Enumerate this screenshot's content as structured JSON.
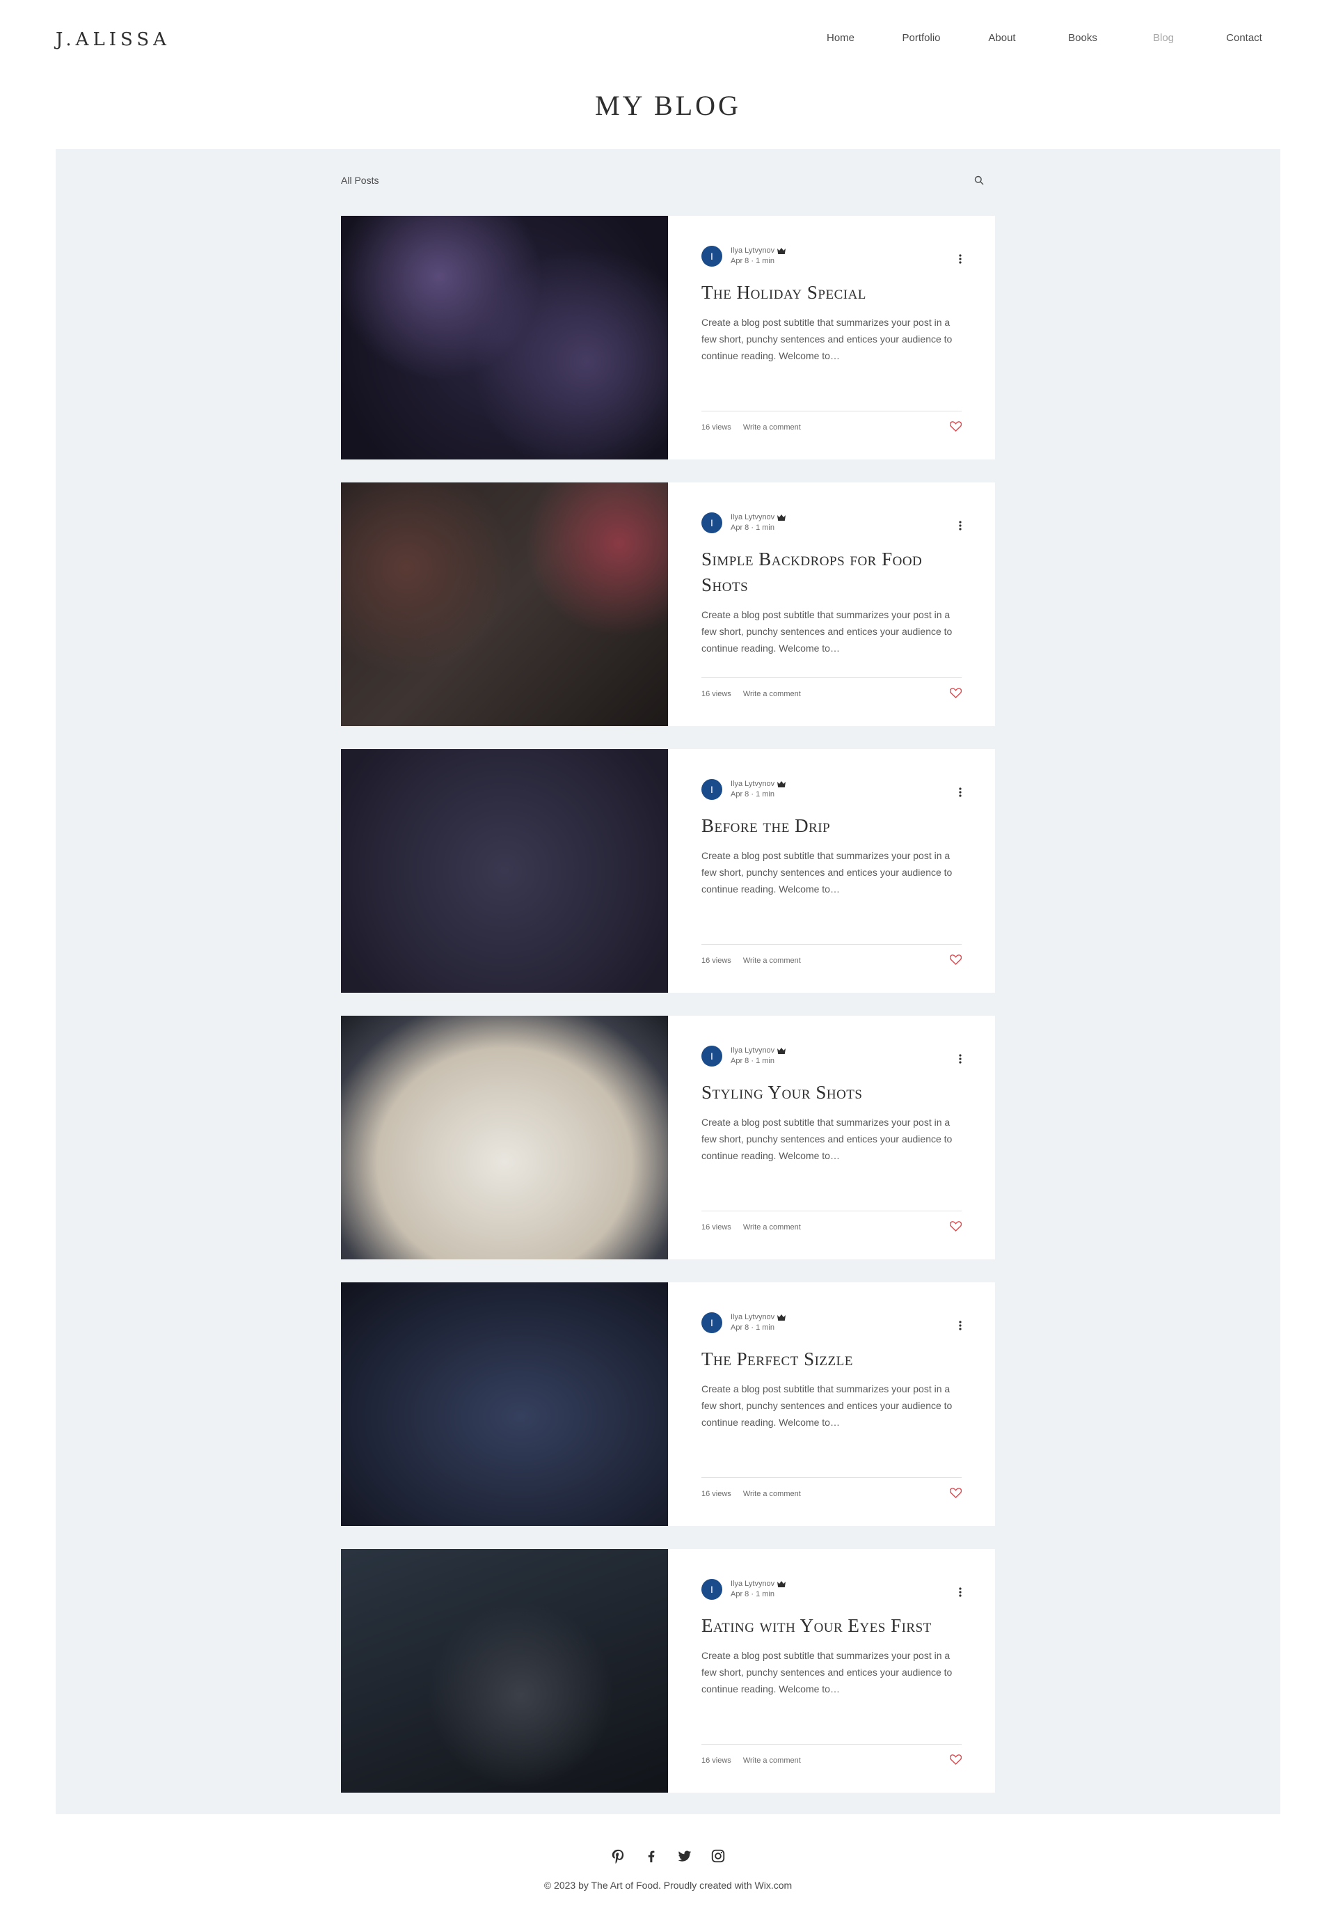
{
  "header": {
    "logo": "J.ALISSA",
    "nav": [
      {
        "label": "Home",
        "active": false
      },
      {
        "label": "Portfolio",
        "active": false
      },
      {
        "label": "About",
        "active": false
      },
      {
        "label": "Books",
        "active": false
      },
      {
        "label": "Blog",
        "active": true
      },
      {
        "label": "Contact",
        "active": false
      }
    ]
  },
  "page_title": "MY BLOG",
  "blog": {
    "filter_label": "All Posts",
    "search_icon": "search-icon",
    "posts": [
      {
        "author": "Ilya Lytvynov",
        "avatar_initial": "I",
        "date": "Apr 8",
        "read_time": "1 min",
        "title": "The Holiday Special",
        "excerpt": "Create a blog post subtitle that summarizes your post in a few short, punchy sentences and entices your audience to continue reading. Welcome to…",
        "views": "16 views",
        "comment_label": "Write a comment"
      },
      {
        "author": "Ilya Lytvynov",
        "avatar_initial": "I",
        "date": "Apr 8",
        "read_time": "1 min",
        "title": "Simple Backdrops for Food Shots",
        "excerpt": "Create a blog post subtitle that summarizes your post in a few short, punchy sentences and entices your audience to continue reading. Welcome to…",
        "views": "16 views",
        "comment_label": "Write a comment"
      },
      {
        "author": "Ilya Lytvynov",
        "avatar_initial": "I",
        "date": "Apr 8",
        "read_time": "1 min",
        "title": "Before the Drip",
        "excerpt": "Create a blog post subtitle that summarizes your post in a few short, punchy sentences and entices your audience to continue reading. Welcome to…",
        "views": "16 views",
        "comment_label": "Write a comment"
      },
      {
        "author": "Ilya Lytvynov",
        "avatar_initial": "I",
        "date": "Apr 8",
        "read_time": "1 min",
        "title": "Styling Your Shots",
        "excerpt": "Create a blog post subtitle that summarizes your post in a few short, punchy sentences and entices your audience to continue reading. Welcome to…",
        "views": "16 views",
        "comment_label": "Write a comment"
      },
      {
        "author": "Ilya Lytvynov",
        "avatar_initial": "I",
        "date": "Apr 8",
        "read_time": "1 min",
        "title": "The Perfect Sizzle",
        "excerpt": "Create a blog post subtitle that summarizes your post in a few short, punchy sentences and entices your audience to continue reading. Welcome to…",
        "views": "16 views",
        "comment_label": "Write a comment"
      },
      {
        "author": "Ilya Lytvynov",
        "avatar_initial": "I",
        "date": "Apr 8",
        "read_time": "1 min",
        "title": "Eating with Your Eyes First",
        "excerpt": "Create a blog post subtitle that summarizes your post in a few short, punchy sentences and entices your audience to continue reading. Welcome to…",
        "views": "16 views",
        "comment_label": "Write a comment"
      }
    ]
  },
  "footer": {
    "social": [
      "pinterest-icon",
      "facebook-icon",
      "twitter-icon",
      "instagram-icon"
    ],
    "copyright_text": "© 2023 by The Art of Food. Proudly created with ",
    "copyright_link": "Wix.com"
  },
  "colors": {
    "accent": "#1a4c8c",
    "strip_bg": "#eef2f5",
    "heart": "#e0474c"
  }
}
